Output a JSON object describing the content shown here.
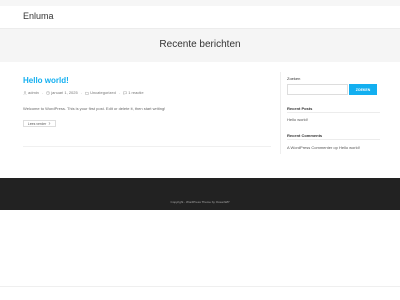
{
  "site": {
    "title": "Enluma"
  },
  "page_header": {
    "title": "Recente berichten"
  },
  "post": {
    "title": "Hello world!",
    "meta": {
      "author": "admin",
      "date": "januari 1, 2025",
      "category": "Uncategorized",
      "comments": "1 reactie"
    },
    "excerpt": "Welcome to WordPress. This is your first post. Edit or delete it, then start writing!",
    "read_more_label": "Lees verder",
    "read_more_icon": "chevron-right-icon"
  },
  "sidebar": {
    "search": {
      "label": "Zoeken",
      "placeholder": "",
      "button_label": "ZOEKEN"
    },
    "recent_posts": {
      "title": "Recent Posts",
      "items": [
        "Hello world!"
      ]
    },
    "recent_comments": {
      "title": "Recent Comments",
      "items": [
        "A WordPress Commenter op Hello world!"
      ]
    }
  },
  "footer": {
    "copyright": "Copyright - WordPress Theme by OceanWP"
  },
  "colors": {
    "accent": "#13aff0",
    "footer_bg": "#222222",
    "page_header_bg": "#f5f5f5"
  },
  "icons": {
    "author": "user-icon",
    "date": "clock-icon",
    "category": "folder-icon",
    "comments": "comment-icon"
  }
}
